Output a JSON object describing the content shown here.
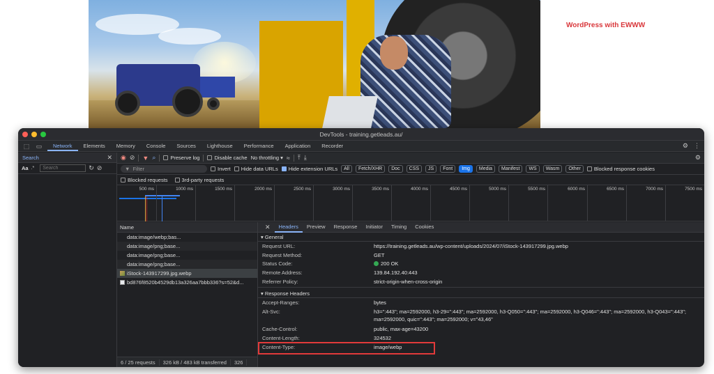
{
  "page": {
    "brand_label": "WordPress with EWWW"
  },
  "devtools": {
    "title": "DevTools - training.getleads.au/",
    "main_tabs": [
      "Network",
      "Elements",
      "Memory",
      "Console",
      "Sources",
      "Lighthouse",
      "Performance",
      "Application",
      "Recorder"
    ],
    "search": {
      "tab_label": "Search",
      "aa_label": "Aa",
      "regex_label": ".*",
      "placeholder": "Search"
    },
    "toolbar": {
      "preserve_log": "Preserve log",
      "disable_cache": "Disable cache",
      "throttling": "No throttling"
    },
    "filter": {
      "placeholder": "Filter",
      "invert": "Invert",
      "hide_data_urls": "Hide data URLs",
      "hide_extension_urls": "Hide extension URLs",
      "chips": [
        "All",
        "Fetch/XHR",
        "Doc",
        "CSS",
        "JS",
        "Font",
        "Img",
        "Media",
        "Manifest",
        "WS",
        "Wasm",
        "Other"
      ],
      "active_chip": "Img",
      "blocked_response_cookies": "Blocked response cookies",
      "blocked_requests": "Blocked requests",
      "third_party_requests": "3rd-party requests"
    },
    "timeline": {
      "ticks": [
        "500 ms",
        "1000 ms",
        "1500 ms",
        "2000 ms",
        "2500 ms",
        "3000 ms",
        "3500 ms",
        "4000 ms",
        "4500 ms",
        "5000 ms",
        "5500 ms",
        "6000 ms",
        "6500 ms",
        "7000 ms",
        "7500 ms"
      ]
    },
    "requests": {
      "header": "Name",
      "items": [
        {
          "name": "data:image/webp;bas...",
          "icon": "image-icon"
        },
        {
          "name": "data:image/png;base...",
          "icon": "image-icon"
        },
        {
          "name": "data:image/png;base...",
          "icon": "image-icon"
        },
        {
          "name": "data:image/png;base...",
          "icon": "image-icon"
        },
        {
          "name": "iStock-143917299.jpg.webp",
          "icon": "image-icon"
        },
        {
          "name": "bd876f8520b4529db13a326aa7bbb336?s=52&d...",
          "icon": "document-icon"
        }
      ],
      "status": [
        "6 / 25 requests",
        "326 kB / 483 kB transferred",
        "326"
      ]
    },
    "detail": {
      "tabs": [
        "Headers",
        "Preview",
        "Response",
        "Initiator",
        "Timing",
        "Cookies"
      ],
      "general_title": "▾ General",
      "general": [
        {
          "k": "Request URL:",
          "v": "https://training.getleads.au/wp-content/uploads/2024/07/iStock-143917299.jpg.webp"
        },
        {
          "k": "Request Method:",
          "v": "GET"
        },
        {
          "k": "Status Code:",
          "v": "200 OK"
        },
        {
          "k": "Remote Address:",
          "v": "139.84.192.40:443"
        },
        {
          "k": "Referrer Policy:",
          "v": "strict-origin-when-cross-origin"
        }
      ],
      "response_title": "▾ Response Headers",
      "response": [
        {
          "k": "Accept-Ranges:",
          "v": "bytes"
        },
        {
          "k": "Alt-Svc:",
          "v": "h3=\":443\"; ma=2592000, h3-29=\":443\"; ma=2592000, h3-Q050=\":443\"; ma=2592000, h3-Q046=\":443\"; ma=2592000, h3-Q043=\":443\"; ma=2592000, quic=\":443\"; ma=2592000; v=\"43,46\""
        },
        {
          "k": "Cache-Control:",
          "v": "public, max-age=43200"
        },
        {
          "k": "Content-Length:",
          "v": "324532"
        },
        {
          "k": "Content-Type:",
          "v": "image/webp"
        }
      ]
    }
  },
  "colors": {
    "accent": "#8ab4f8",
    "highlight": "#e23a3a",
    "brand": "#d9373b",
    "status_ok": "#34a853"
  }
}
